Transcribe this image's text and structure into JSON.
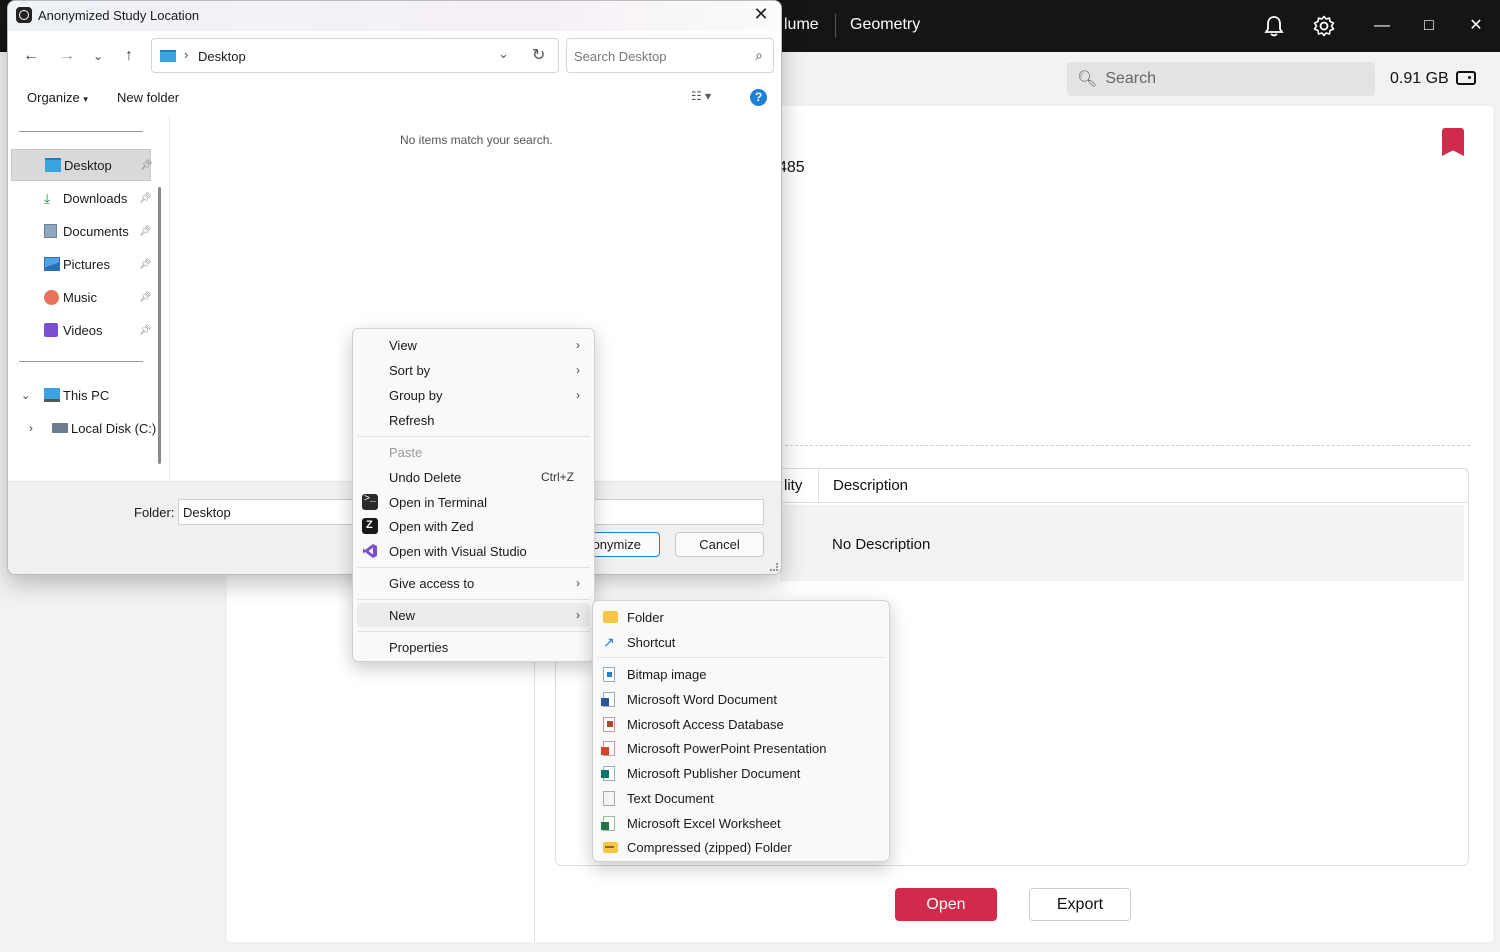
{
  "app": {
    "tab_partial": "lume",
    "tab_geometry": "Geometry",
    "search_placeholder": "Search",
    "storage": "0.91 GB",
    "number_partial": "485",
    "desc_header_partial": "lity",
    "desc_header": "Description",
    "desc_value": "No Description",
    "open_label": "Open",
    "export_label": "Export",
    "accent": "#d12a4a"
  },
  "dialog": {
    "title": "Anonymized Study Location",
    "address": "Desktop",
    "search_placeholder": "Search Desktop",
    "organize": "Organize",
    "new_folder": "New folder",
    "empty_message": "No items match your search.",
    "folder_label": "Folder:",
    "folder_value": "Desktop",
    "primary_button": "onymize",
    "cancel_button": "Cancel",
    "nav": {
      "quick": [
        {
          "label": "Desktop",
          "icon": "desktop-icon"
        },
        {
          "label": "Downloads",
          "icon": "downloads-icon"
        },
        {
          "label": "Documents",
          "icon": "documents-icon"
        },
        {
          "label": "Pictures",
          "icon": "pictures-icon"
        },
        {
          "label": "Music",
          "icon": "music-icon"
        },
        {
          "label": "Videos",
          "icon": "videos-icon"
        }
      ],
      "this_pc": "This PC",
      "local_disk": "Local Disk (C:)"
    }
  },
  "context_menu": {
    "view": "View",
    "sort_by": "Sort by",
    "group_by": "Group by",
    "refresh": "Refresh",
    "paste": "Paste",
    "undo_delete": "Undo Delete",
    "undo_shortcut": "Ctrl+Z",
    "open_terminal": "Open in Terminal",
    "open_zed": "Open with Zed",
    "open_vs": "Open with Visual Studio",
    "give_access": "Give access to",
    "new": "New",
    "properties": "Properties"
  },
  "new_submenu": {
    "folder": "Folder",
    "shortcut": "Shortcut",
    "items": [
      "Bitmap image",
      "Microsoft Word Document",
      "Microsoft Access Database",
      "Microsoft PowerPoint Presentation",
      "Microsoft Publisher Document",
      "Text Document",
      "Microsoft Excel Worksheet",
      "Compressed (zipped) Folder"
    ]
  }
}
